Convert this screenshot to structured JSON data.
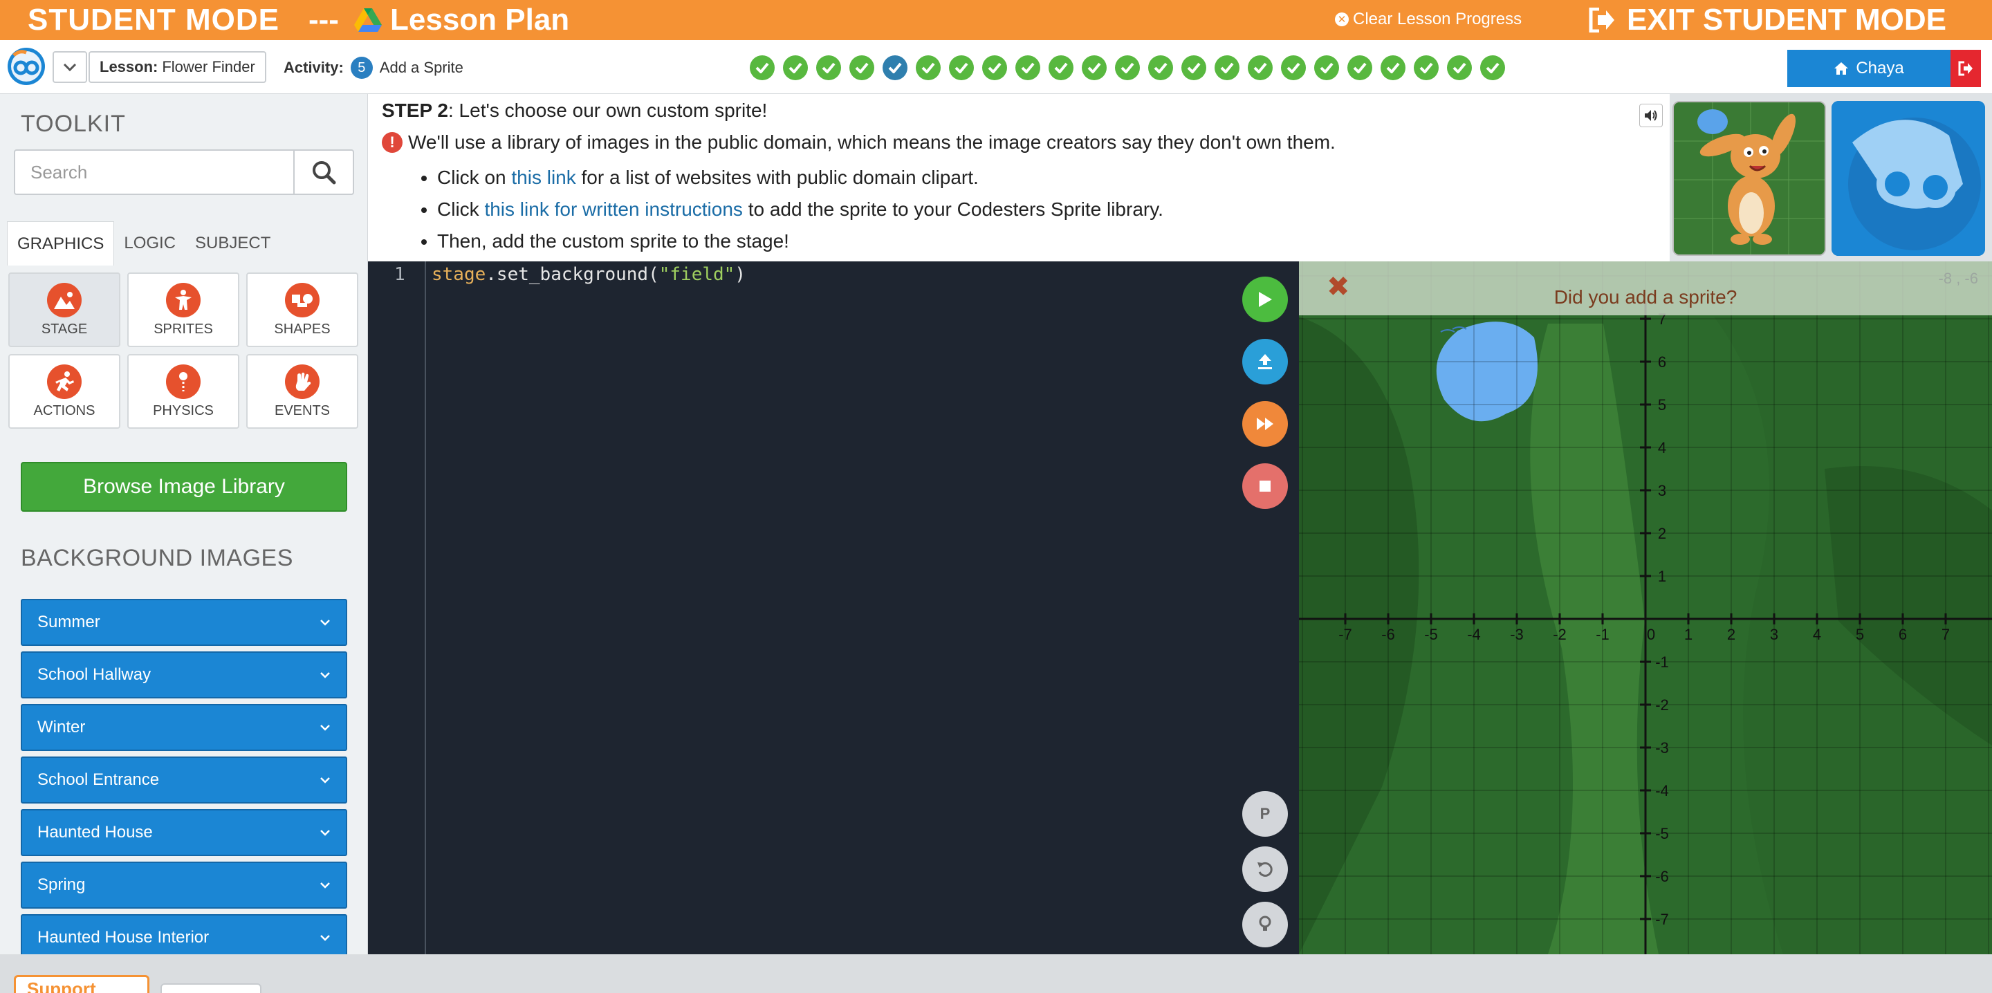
{
  "topbar": {
    "mode_label": "STUDENT MODE",
    "separator": "---",
    "plan_label": "Lesson Plan",
    "clear_label": "Clear Lesson Progress",
    "exit_label": "EXIT STUDENT MODE"
  },
  "navbar": {
    "lesson_prefix": "Lesson:",
    "lesson_name": "Flower Finder",
    "activity_prefix": "Activity:",
    "activity_number": "5",
    "activity_name": "Add a Sprite",
    "progress_total": 23,
    "progress_current_index": 4,
    "user_name": "Chaya"
  },
  "toolkit": {
    "title": "TOOLKIT",
    "search_placeholder": "Search",
    "tabs": [
      "GRAPHICS",
      "LOGIC",
      "SUBJECT"
    ],
    "tiles": [
      {
        "label": "STAGE",
        "icon": "stage-icon"
      },
      {
        "label": "SPRITES",
        "icon": "sprites-icon"
      },
      {
        "label": "SHAPES",
        "icon": "shapes-icon"
      },
      {
        "label": "ACTIONS",
        "icon": "actions-icon"
      },
      {
        "label": "PHYSICS",
        "icon": "physics-icon"
      },
      {
        "label": "EVENTS",
        "icon": "events-icon"
      }
    ],
    "browse_label": "Browse Image Library",
    "bg_title": "BACKGROUND IMAGES",
    "bg_items": [
      "Summer",
      "School Hallway",
      "Winter",
      "School Entrance",
      "Haunted House",
      "Spring",
      "Haunted House Interior"
    ]
  },
  "instructions": {
    "step_label": "STEP 2",
    "step_text": ": Let's choose our own custom sprite!",
    "note": "We'll use a library of images in the public domain, which means the image creators say they don't own them.",
    "bullet1_pre": "Click on ",
    "bullet1_link": "this link",
    "bullet1_post": " for a list of websites with public domain clipart.",
    "bullet2_pre": "Click ",
    "bullet2_link": "this link for written instructions",
    "bullet2_post": " to add the sprite to your Codesters Sprite library.",
    "bullet3": "Then, add the custom sprite to the stage!"
  },
  "editor": {
    "line_number": "1",
    "code_obj": "stage",
    "code_fn": ".set_background(",
    "code_str": "\"field\"",
    "code_end": ")"
  },
  "controls": {
    "p_label": "P"
  },
  "stage": {
    "banner_message": "Did you add a sprite?",
    "coord_readout": "-8 , -6",
    "x_ticks": [
      -7,
      -6,
      -5,
      -4,
      -3,
      -2,
      -1,
      0,
      1,
      2,
      3,
      4,
      5,
      6,
      7
    ],
    "y_ticks": [
      7,
      6,
      5,
      4,
      3,
      2,
      1,
      -1,
      -2,
      -3,
      -4,
      -5,
      -6,
      -7
    ]
  },
  "bottombar": {
    "support_label": "Support"
  },
  "colors": {
    "brand_orange": "#f59234",
    "primary_blue": "#1b86d4",
    "success_green": "#43a83b",
    "editor_bg": "#1e2530",
    "stage_green": "#2e6b2e"
  }
}
